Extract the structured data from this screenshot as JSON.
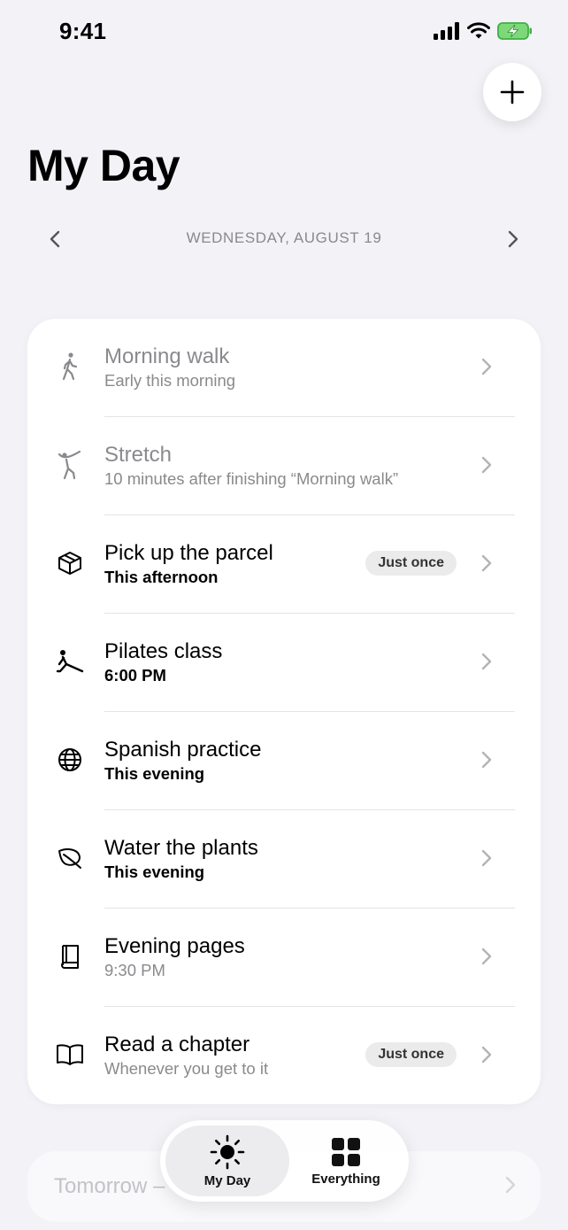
{
  "status_bar": {
    "time": "9:41"
  },
  "header": {
    "title": "My Day",
    "date": "WEDNESDAY, AUGUST 19"
  },
  "tasks": [
    {
      "title": "Morning walk",
      "subtitle": "Early this morning",
      "icon": "walking-icon",
      "done": true
    },
    {
      "title": "Stretch",
      "subtitle": "10 minutes after finishing “Morning walk”",
      "icon": "stretch-icon",
      "done": true
    },
    {
      "title": "Pick up the parcel",
      "subtitle": "This afternoon",
      "icon": "box-icon",
      "badge": "Just once"
    },
    {
      "title": "Pilates class",
      "subtitle": "6:00 PM",
      "icon": "pilates-icon"
    },
    {
      "title": "Spanish practice",
      "subtitle": "This evening",
      "icon": "globe-icon"
    },
    {
      "title": "Water the plants",
      "subtitle": "This evening",
      "icon": "leaf-icon"
    },
    {
      "title": "Evening pages",
      "subtitle": "9:30 PM",
      "icon": "notebook-icon"
    },
    {
      "title": "Read a chapter",
      "subtitle": "Whenever you get to it",
      "icon": "book-icon",
      "badge": "Just once"
    }
  ],
  "tomorrow": {
    "label": "Tomorrow –"
  },
  "tabbar": {
    "my_day": "My Day",
    "everything": "Everything"
  }
}
